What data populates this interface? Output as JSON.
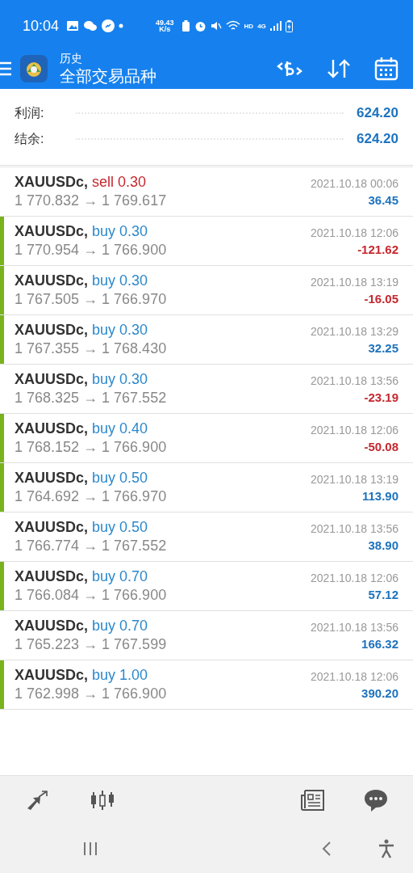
{
  "status_bar": {
    "time": "10:04",
    "speed": "49.43",
    "speed_unit": "K/s",
    "hd": "HD",
    "network": "4G"
  },
  "header": {
    "subtitle": "历史",
    "title": "全部交易品种"
  },
  "summary": [
    {
      "label": "利润:",
      "value": "624.20"
    },
    {
      "label": "结余:",
      "value": "624.20"
    }
  ],
  "trades": [
    {
      "symbol": "XAUUSDc,",
      "side": "sell",
      "short": true,
      "lots": "0.30",
      "prices": "1 770.832 → 1 769.617",
      "time": "2021.10.18 00:06",
      "profit": "36.45",
      "loss": false,
      "marked": false
    },
    {
      "symbol": "XAUUSDc,",
      "side": "buy",
      "short": false,
      "lots": "0.30",
      "prices": "1 770.954 → 1 766.900",
      "time": "2021.10.18 12:06",
      "profit": "-121.62",
      "loss": true,
      "marked": true
    },
    {
      "symbol": "XAUUSDc,",
      "side": "buy",
      "short": false,
      "lots": "0.30",
      "prices": "1 767.505 → 1 766.970",
      "time": "2021.10.18 13:19",
      "profit": "-16.05",
      "loss": true,
      "marked": true
    },
    {
      "symbol": "XAUUSDc,",
      "side": "buy",
      "short": false,
      "lots": "0.30",
      "prices": "1 767.355 → 1 768.430",
      "time": "2021.10.18 13:29",
      "profit": "32.25",
      "loss": false,
      "marked": true
    },
    {
      "symbol": "XAUUSDc,",
      "side": "buy",
      "short": false,
      "lots": "0.30",
      "prices": "1 768.325 → 1 767.552",
      "time": "2021.10.18 13:56",
      "profit": "-23.19",
      "loss": true,
      "marked": false
    },
    {
      "symbol": "XAUUSDc,",
      "side": "buy",
      "short": false,
      "lots": "0.40",
      "prices": "1 768.152 → 1 766.900",
      "time": "2021.10.18 12:06",
      "profit": "-50.08",
      "loss": true,
      "marked": true
    },
    {
      "symbol": "XAUUSDc,",
      "side": "buy",
      "short": false,
      "lots": "0.50",
      "prices": "1 764.692 → 1 766.970",
      "time": "2021.10.18 13:19",
      "profit": "113.90",
      "loss": false,
      "marked": true
    },
    {
      "symbol": "XAUUSDc,",
      "side": "buy",
      "short": false,
      "lots": "0.50",
      "prices": "1 766.774 → 1 767.552",
      "time": "2021.10.18 13:56",
      "profit": "38.90",
      "loss": false,
      "marked": false
    },
    {
      "symbol": "XAUUSDc,",
      "side": "buy",
      "short": false,
      "lots": "0.70",
      "prices": "1 766.084 → 1 766.900",
      "time": "2021.10.18 12:06",
      "profit": "57.12",
      "loss": false,
      "marked": true
    },
    {
      "symbol": "XAUUSDc,",
      "side": "buy",
      "short": false,
      "lots": "0.70",
      "prices": "1 765.223 → 1 767.599",
      "time": "2021.10.18 13:56",
      "profit": "166.32",
      "loss": false,
      "marked": false
    },
    {
      "symbol": "XAUUSDc,",
      "side": "buy",
      "short": false,
      "lots": "1.00",
      "prices": "1 762.998 → 1 766.900",
      "time": "2021.10.18 12:06",
      "profit": "390.20",
      "loss": false,
      "marked": true
    }
  ]
}
